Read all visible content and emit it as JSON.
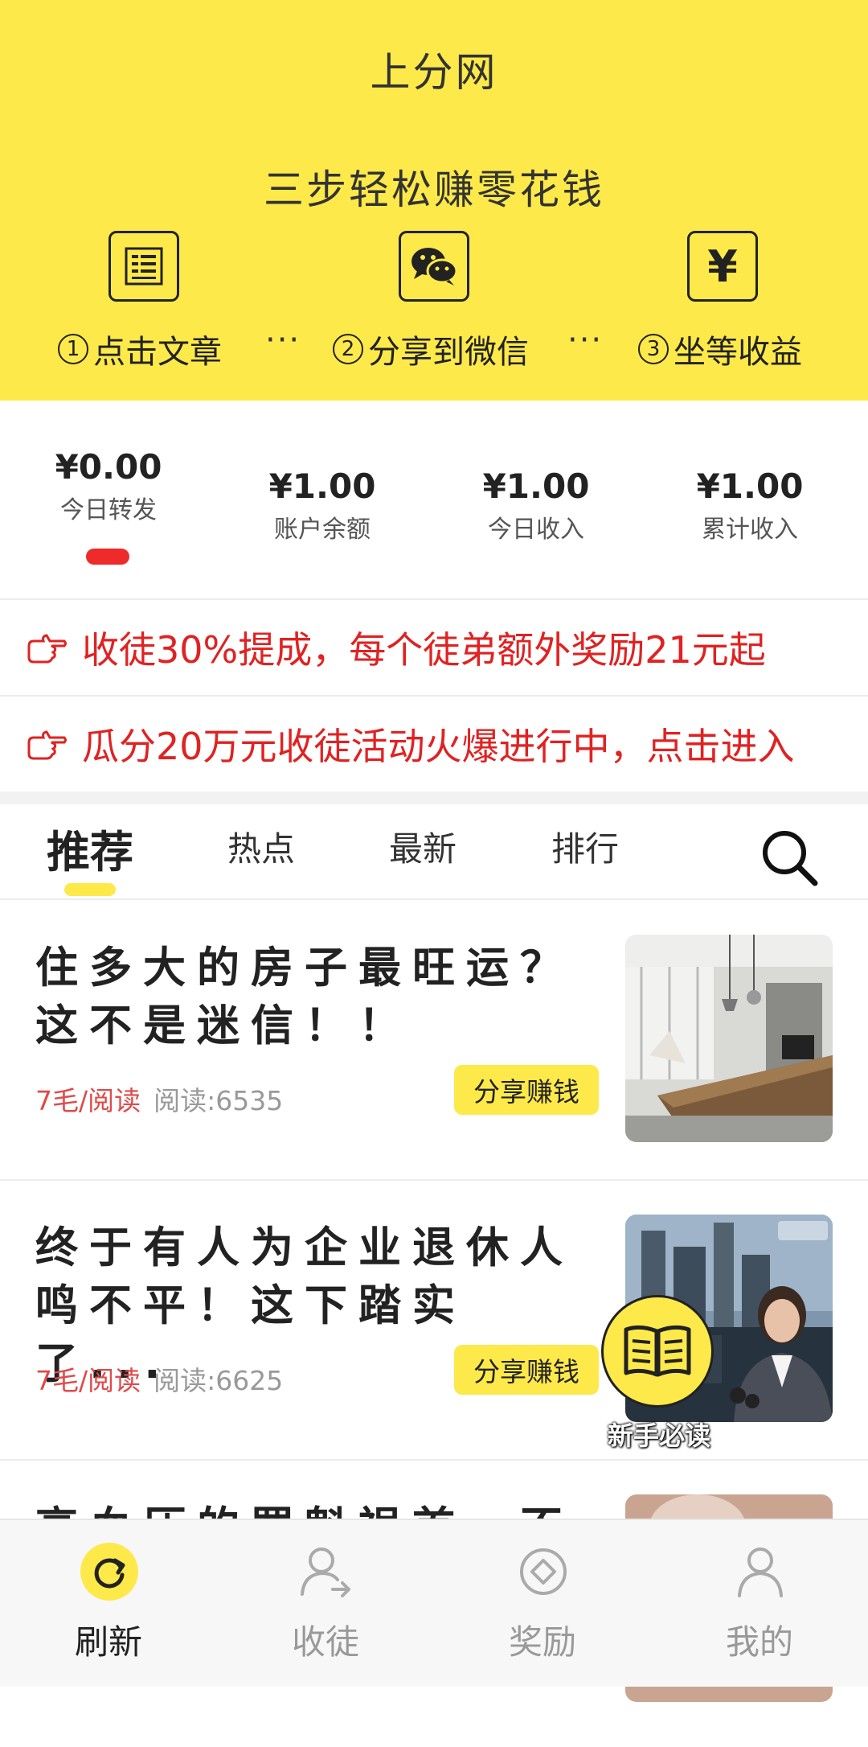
{
  "header": {
    "title": "上分网",
    "slogan": "三步轻松赚零花钱",
    "steps": [
      {
        "num": "1",
        "label": "点击文章",
        "icon": "article-list-icon"
      },
      {
        "num": "2",
        "label": "分享到微信",
        "icon": "wechat-icon"
      },
      {
        "num": "3",
        "label": "坐等收益",
        "icon": "yuan-icon"
      }
    ],
    "separator": "···",
    "yuan_symbol": "¥"
  },
  "stats": [
    {
      "value": "¥0.00",
      "label": "今日转发"
    },
    {
      "value": "¥1.00",
      "label": "账户余额"
    },
    {
      "value": "¥1.00",
      "label": "今日收入"
    },
    {
      "value": "¥1.00",
      "label": "累计收入"
    }
  ],
  "notices": [
    {
      "text": "收徒30%提成，每个徒弟额外奖励21元起",
      "icon": "pointing-hand-icon"
    },
    {
      "text": "瓜分20万元收徒活动火爆进行中，点击进入",
      "icon": "pointing-hand-icon"
    }
  ],
  "tabs": [
    {
      "label": "推荐",
      "active": true
    },
    {
      "label": "热点",
      "active": false
    },
    {
      "label": "最新",
      "active": false
    },
    {
      "label": "排行",
      "active": false
    }
  ],
  "articles": [
    {
      "title": "住多大的房子最旺运？这不是迷信！！",
      "price": "7毛/阅读",
      "reads": "阅读:6535",
      "share": "分享赚钱"
    },
    {
      "title": "终于有人为企业退休人鸣不平！这下踏实了...",
      "price": "7毛/阅读",
      "reads": "阅读:6625",
      "share": "分享赚钱"
    },
    {
      "title": "高血压的罪魁祸首，不",
      "price": "",
      "reads": "",
      "share": ""
    }
  ],
  "guide": {
    "label": "新手必读",
    "icon": "open-book-icon"
  },
  "bottom_nav": [
    {
      "label": "刷新",
      "icon": "refresh-icon",
      "active": true
    },
    {
      "label": "收徒",
      "icon": "add-follower-icon",
      "active": false
    },
    {
      "label": "奖励",
      "icon": "reward-diamond-icon",
      "active": false
    },
    {
      "label": "我的",
      "icon": "user-profile-icon",
      "active": false
    }
  ],
  "colors": {
    "brand_yellow": "#fde94a",
    "notice_red": "#e02222",
    "indicator_red": "#ee2a2a"
  }
}
